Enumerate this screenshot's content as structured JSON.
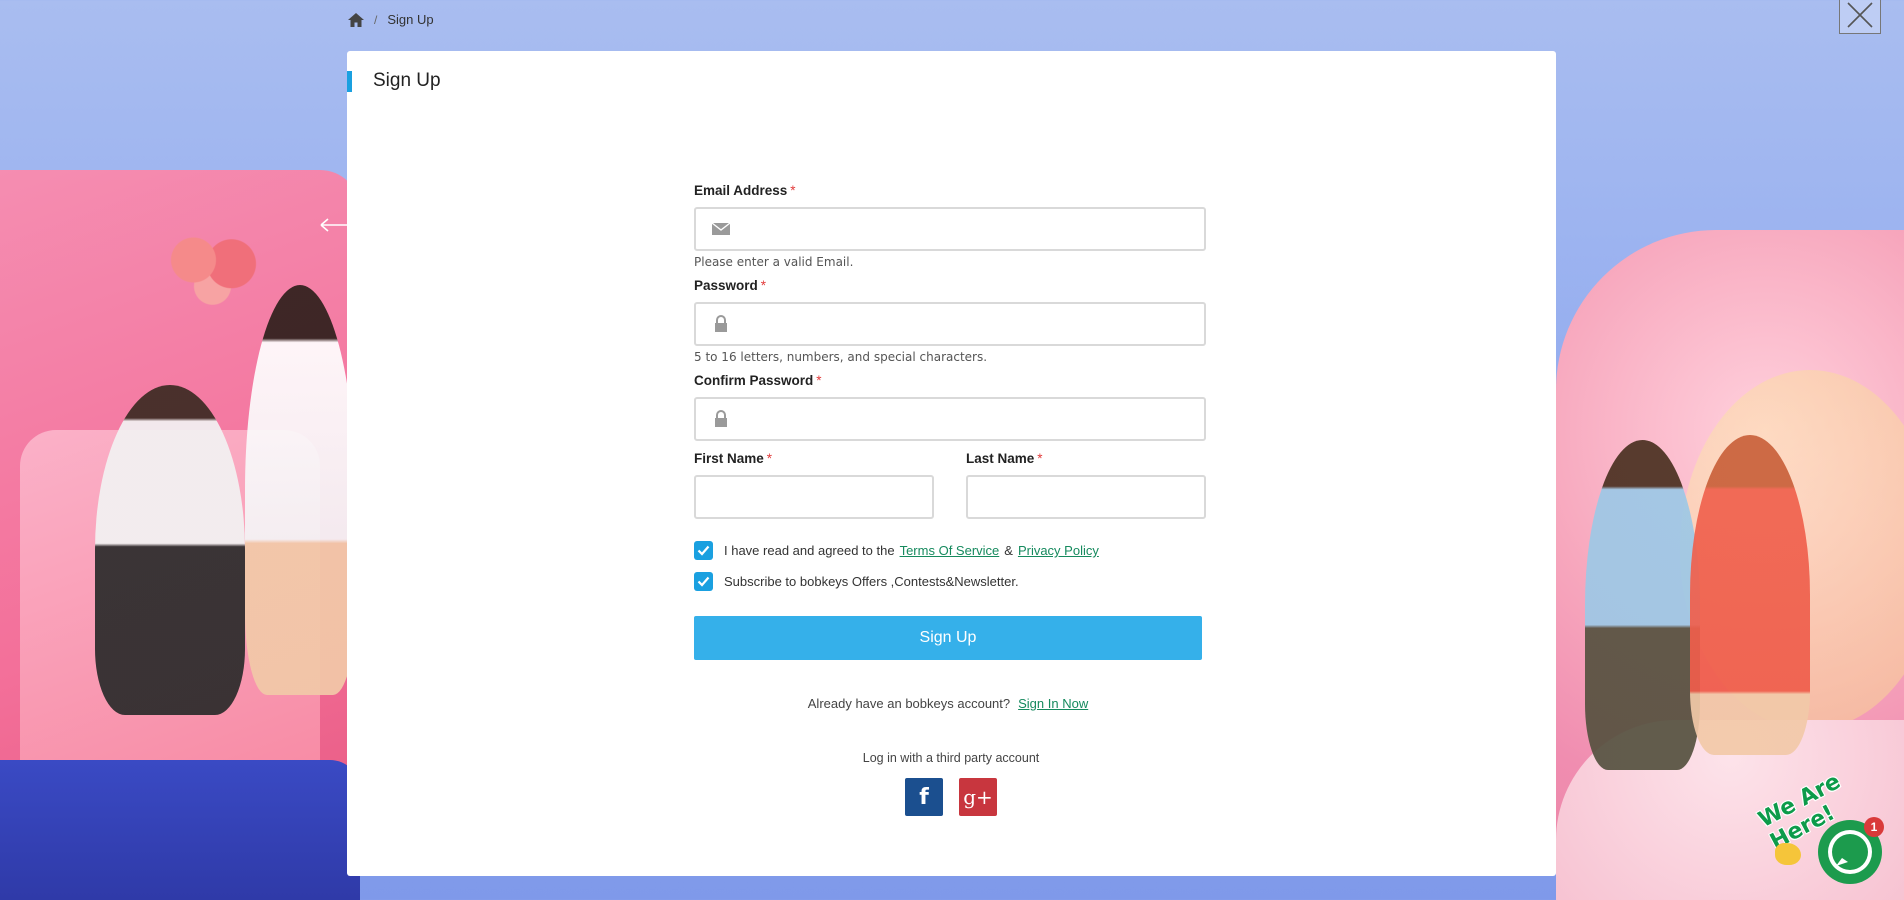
{
  "breadcrumb": {
    "current": "Sign Up"
  },
  "modal": {
    "title": "Sign Up"
  },
  "form": {
    "email": {
      "label": "Email Address",
      "required": "*",
      "value": "",
      "placeholder": "",
      "hint": "Please enter a valid Email."
    },
    "password": {
      "label": "Password",
      "required": "*",
      "value": "",
      "placeholder": "",
      "hint": "5 to 16 letters, numbers, and special characters."
    },
    "confirm_password": {
      "label": "Confirm Password",
      "required": "*",
      "value": "",
      "placeholder": ""
    },
    "first_name": {
      "label": "First Name",
      "required": "*",
      "value": ""
    },
    "last_name": {
      "label": "Last Name",
      "required": "*",
      "value": ""
    },
    "agree": {
      "checked": true,
      "text": "I have read and agreed to the",
      "terms_link": "Terms Of Service",
      "amp": "&",
      "privacy_link": "Privacy Policy"
    },
    "subscribe": {
      "checked": true,
      "text": "Subscribe to bobkeys Offers ,Contests&Newsletter."
    },
    "submit_label": "Sign Up"
  },
  "signin": {
    "text": "Already have an bobkeys account?",
    "link": "Sign In Now"
  },
  "third_party": {
    "text": "Log in with a third party account",
    "facebook_glyph": "f",
    "google_glyph": "g+"
  },
  "chat": {
    "tagline": "We Are Here!",
    "badge_count": "1"
  },
  "colors": {
    "accent": "#35b0ea",
    "link": "#168a5e",
    "required": "#e23b3b",
    "facebook": "#1b4f8f",
    "google": "#c8363e",
    "chat": "#1c9b4d"
  }
}
